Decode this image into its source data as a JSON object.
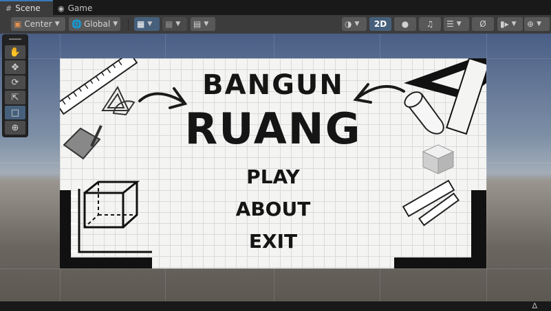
{
  "tabs": [
    {
      "label": "Scene",
      "icon": "grid-icon",
      "active": true
    },
    {
      "label": "Game",
      "icon": "gamepad-icon",
      "active": false
    }
  ],
  "toolbar": {
    "pivot_label": "Center",
    "space_label": "Global",
    "two_d_label": "2D"
  },
  "game_screen": {
    "title_line1": "BANGUN",
    "title_line2": "RUANG",
    "menu": [
      "PLAY",
      "ABOUT",
      "EXIT"
    ]
  },
  "status": {
    "icon": "lock-icon"
  },
  "colors": {
    "accent": "#3a79bb",
    "toggle_on": "#46607c",
    "panel": "#3c3c3c"
  }
}
